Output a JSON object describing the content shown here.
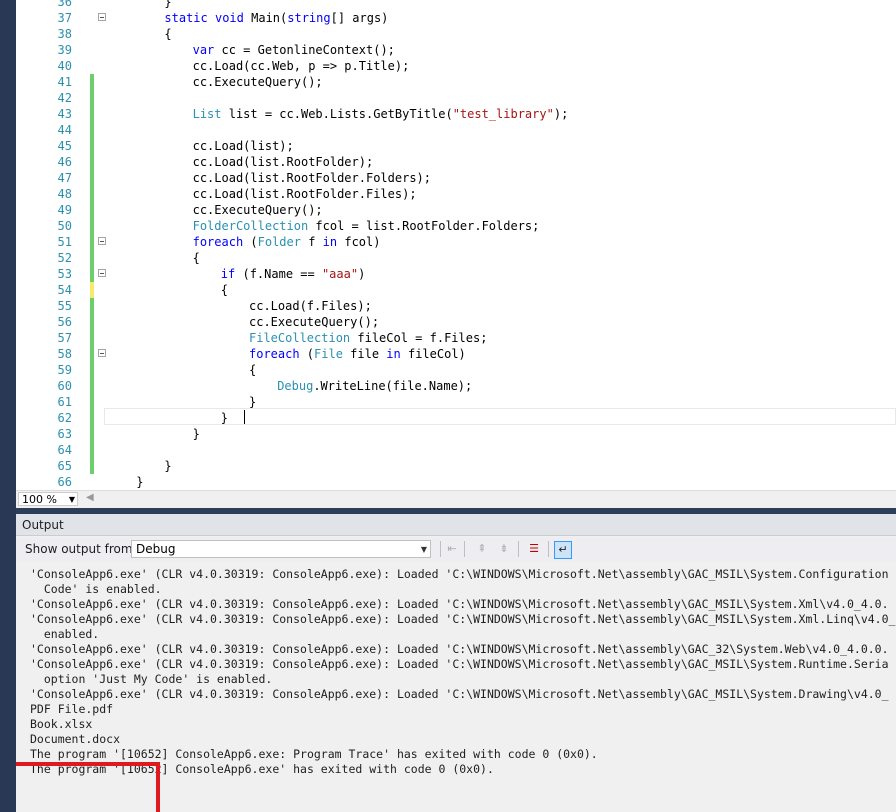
{
  "editor": {
    "lines": [
      {
        "n": "36",
        "code": "}",
        "indent": "        ",
        "bar": "",
        "fold": false
      },
      {
        "n": "37",
        "code": "static void Main(string[] args)",
        "indent": "        ",
        "bar": "",
        "fold": true,
        "kind": "main"
      },
      {
        "n": "38",
        "code": "{",
        "indent": "        ",
        "bar": "",
        "fold": false
      },
      {
        "n": "39",
        "code": "var cc = GetonlineContext();",
        "indent": "            ",
        "bar": "",
        "fold": false,
        "kind": "var"
      },
      {
        "n": "40",
        "code": "cc.Load(cc.Web, p => p.Title);",
        "indent": "            ",
        "bar": "",
        "fold": false
      },
      {
        "n": "41",
        "code": "cc.ExecuteQuery();",
        "indent": "            ",
        "bar": "green",
        "fold": false
      },
      {
        "n": "42",
        "code": "",
        "indent": "",
        "bar": "green",
        "fold": false
      },
      {
        "n": "43",
        "code": "List list = cc.Web.Lists.GetByTitle(\"test_library\");",
        "indent": "            ",
        "bar": "green",
        "fold": false,
        "kind": "list"
      },
      {
        "n": "44",
        "code": "",
        "indent": "",
        "bar": "green",
        "fold": false
      },
      {
        "n": "45",
        "code": "cc.Load(list);",
        "indent": "            ",
        "bar": "green",
        "fold": false
      },
      {
        "n": "46",
        "code": "cc.Load(list.RootFolder);",
        "indent": "            ",
        "bar": "green",
        "fold": false
      },
      {
        "n": "47",
        "code": "cc.Load(list.RootFolder.Folders);",
        "indent": "            ",
        "bar": "green",
        "fold": false
      },
      {
        "n": "48",
        "code": "cc.Load(list.RootFolder.Files);",
        "indent": "            ",
        "bar": "green",
        "fold": false
      },
      {
        "n": "49",
        "code": "cc.ExecuteQuery();",
        "indent": "            ",
        "bar": "green",
        "fold": false
      },
      {
        "n": "50",
        "code": "FolderCollection fcol = list.RootFolder.Folders;",
        "indent": "            ",
        "bar": "green",
        "fold": false,
        "kind": "fcol"
      },
      {
        "n": "51",
        "code": "foreach (Folder f in fcol)",
        "indent": "            ",
        "bar": "green",
        "fold": true,
        "kind": "foreach1"
      },
      {
        "n": "52",
        "code": "{",
        "indent": "            ",
        "bar": "green",
        "fold": false
      },
      {
        "n": "53",
        "code": "if (f.Name == \"aaa\")",
        "indent": "                ",
        "bar": "green",
        "fold": true,
        "kind": "if"
      },
      {
        "n": "54",
        "code": "{",
        "indent": "                ",
        "bar": "yellow",
        "fold": false
      },
      {
        "n": "55",
        "code": "cc.Load(f.Files);",
        "indent": "                    ",
        "bar": "green",
        "fold": false
      },
      {
        "n": "56",
        "code": "cc.ExecuteQuery();",
        "indent": "                    ",
        "bar": "green",
        "fold": false
      },
      {
        "n": "57",
        "code": "FileCollection fileCol = f.Files;",
        "indent": "                    ",
        "bar": "green",
        "fold": false,
        "kind": "filecol"
      },
      {
        "n": "58",
        "code": "foreach (File file in fileCol)",
        "indent": "                    ",
        "bar": "green",
        "fold": true,
        "kind": "foreach2"
      },
      {
        "n": "59",
        "code": "{",
        "indent": "                    ",
        "bar": "green",
        "fold": false
      },
      {
        "n": "60",
        "code": "Debug.WriteLine(file.Name);",
        "indent": "                        ",
        "bar": "green",
        "fold": false,
        "kind": "debug"
      },
      {
        "n": "61",
        "code": "}",
        "indent": "                    ",
        "bar": "green",
        "fold": false
      },
      {
        "n": "62",
        "code": "}",
        "indent": "                ",
        "bar": "green",
        "fold": false
      },
      {
        "n": "63",
        "code": "}",
        "indent": "            ",
        "bar": "green",
        "fold": false
      },
      {
        "n": "64",
        "code": "",
        "indent": "",
        "bar": "green",
        "fold": false
      },
      {
        "n": "65",
        "code": "}",
        "indent": "        ",
        "bar": "green",
        "fold": false
      },
      {
        "n": "66",
        "code": "}",
        "indent": "    ",
        "bar": "",
        "fold": false
      }
    ]
  },
  "zoom": {
    "value": "100 %"
  },
  "output": {
    "title": "Output",
    "show_label": "Show output from:",
    "source": "Debug",
    "lines": [
      "'ConsoleApp6.exe' (CLR v4.0.30319: ConsoleApp6.exe): Loaded 'C:\\WINDOWS\\Microsoft.Net\\assembly\\GAC_MSIL\\System.Configuration",
      "  Code' is enabled.",
      "'ConsoleApp6.exe' (CLR v4.0.30319: ConsoleApp6.exe): Loaded 'C:\\WINDOWS\\Microsoft.Net\\assembly\\GAC_MSIL\\System.Xml\\v4.0_4.0.",
      "'ConsoleApp6.exe' (CLR v4.0.30319: ConsoleApp6.exe): Loaded 'C:\\WINDOWS\\Microsoft.Net\\assembly\\GAC_MSIL\\System.Xml.Linq\\v4.0_4",
      "  enabled.",
      "'ConsoleApp6.exe' (CLR v4.0.30319: ConsoleApp6.exe): Loaded 'C:\\WINDOWS\\Microsoft.Net\\assembly\\GAC_32\\System.Web\\v4.0_4.0.0.",
      "'ConsoleApp6.exe' (CLR v4.0.30319: ConsoleApp6.exe): Loaded 'C:\\WINDOWS\\Microsoft.Net\\assembly\\GAC_MSIL\\System.Runtime.Seria",
      "  option 'Just My Code' is enabled.",
      "'ConsoleApp6.exe' (CLR v4.0.30319: ConsoleApp6.exe): Loaded 'C:\\WINDOWS\\Microsoft.Net\\assembly\\GAC_MSIL\\System.Drawing\\v4.0_",
      "PDF File.pdf",
      "Book.xlsx",
      "Document.docx",
      "The program '[10652] ConsoleApp6.exe: Program Trace' has exited with code 0 (0x0).",
      "The program '[10652] ConsoleApp6.exe' has exited with code 0 (0x0)."
    ]
  },
  "colors": {
    "change_saved": "#6ccf6c",
    "change_unsaved": "#f4ea6b",
    "highlight": "#e0191f"
  }
}
